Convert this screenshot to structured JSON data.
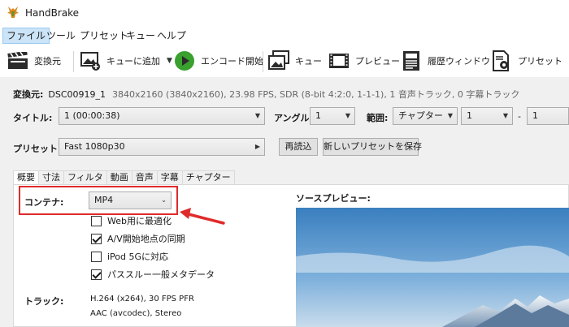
{
  "window": {
    "title": "HandBrake"
  },
  "menu": [
    "ファイル",
    "ツール",
    "プリセット",
    "キュー",
    "ヘルプ"
  ],
  "toolbar": {
    "source": "変換元",
    "add_queue": "キューに追加",
    "encode": "エンコード開始",
    "queue": "キュー",
    "preview": "プレビュー",
    "activity": "履歴ウィンドウ",
    "presets": "プリセット"
  },
  "source": {
    "label": "変換元:",
    "name": "DSC00919_1",
    "info": "3840x2160 (3840x2160), 23.98 FPS, SDR (8-bit 4:2:0, 1-1-1), 1 音声トラック, 0 字幕トラック"
  },
  "title_row": {
    "title_label": "タイトル:",
    "title_value": "1  (00:00:38)",
    "angle_label": "アングル:",
    "angle_value": "1",
    "range_label": "範囲:",
    "range_mode": "チャプター",
    "range_start": "1",
    "range_dash": "-",
    "range_end": "1"
  },
  "preset_row": {
    "label": "プリセット:",
    "value": "Fast 1080p30",
    "reload": "再読込",
    "save_new": "新しいプリセットを保存"
  },
  "tabs": [
    "概要",
    "寸法",
    "フィルタ",
    "動画",
    "音声",
    "字幕",
    "チャプター"
  ],
  "summary": {
    "container_label": "コンテナ:",
    "container_value": "MP4",
    "options": [
      {
        "label": "Web用に最適化",
        "checked": false
      },
      {
        "label": "A/V開始地点の同期",
        "checked": true
      },
      {
        "label": "iPod 5Gに対応",
        "checked": false
      },
      {
        "label": "パススルー一般メタデータ",
        "checked": true
      }
    ],
    "tracks_label": "トラック:",
    "tracks": [
      "H.264 (x264), 30 FPS PFR",
      "AAC (avcodec), Stereo"
    ]
  },
  "preview_label": "ソースプレビュー:",
  "colors": {
    "highlight": "#e02b2b",
    "accent": "#0078d7"
  }
}
